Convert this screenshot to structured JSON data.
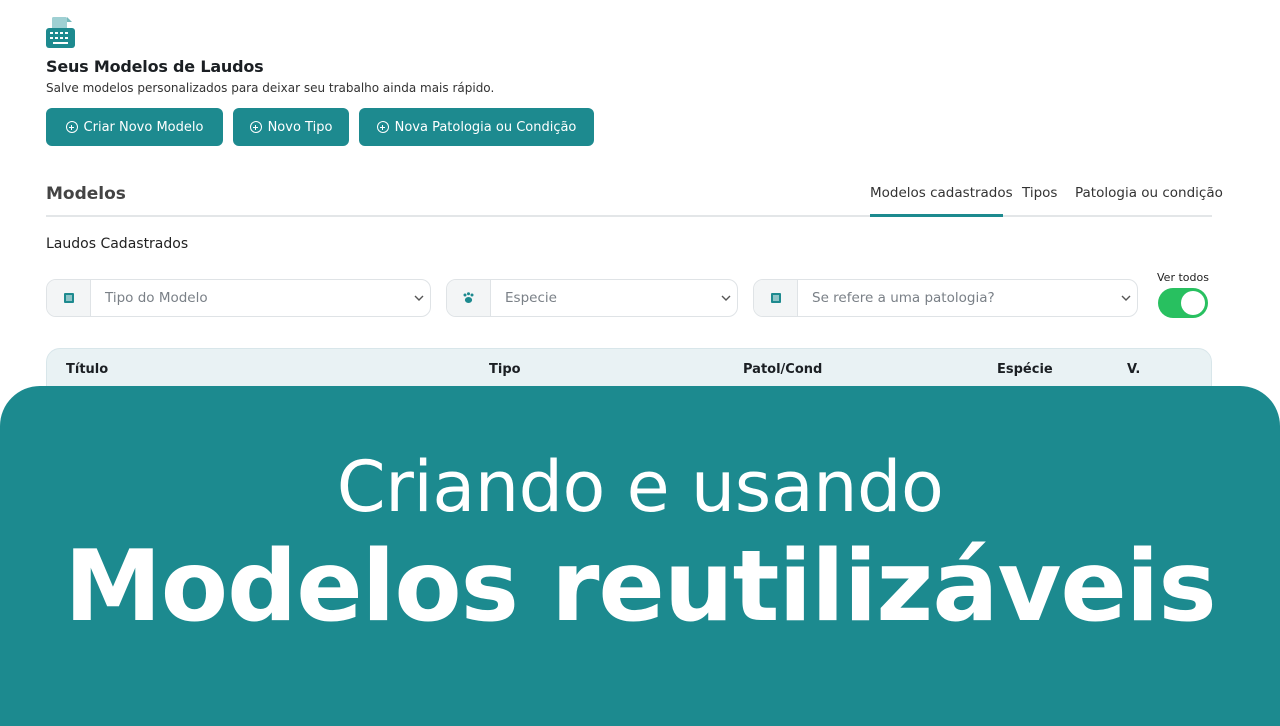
{
  "header": {
    "title": "Seus Modelos de Laudos",
    "subtitle": "Salve modelos personalizados para deixar seu trabalho ainda mais rápido."
  },
  "actions": {
    "criar": "Criar Novo Modelo",
    "tipo": "Novo Tipo",
    "patologia": "Nova Patologia ou Condição"
  },
  "section": {
    "title": "Modelos",
    "tabs": [
      {
        "label": "Modelos cadastrados",
        "active": true
      },
      {
        "label": "Tipos",
        "active": false
      },
      {
        "label": "Patologia ou condição",
        "active": false
      }
    ],
    "list_label": "Laudos Cadastrados"
  },
  "filters": {
    "tipo_modelo": "Tipo do Modelo",
    "especie": "Especie",
    "patologia": "Se refere a uma patologia?",
    "ver_todos_label": "Ver todos",
    "ver_todos_on": true
  },
  "table": {
    "columns": [
      "Título",
      "Tipo",
      "Patol/Cond",
      "Espécie",
      "V."
    ]
  },
  "overlay": {
    "line1": "Criando e usando",
    "line2": "Modelos reutilizáveis"
  },
  "colors": {
    "accent": "#1d8a8f",
    "toggle": "#28c060",
    "overlay": "#1c8a8f"
  }
}
